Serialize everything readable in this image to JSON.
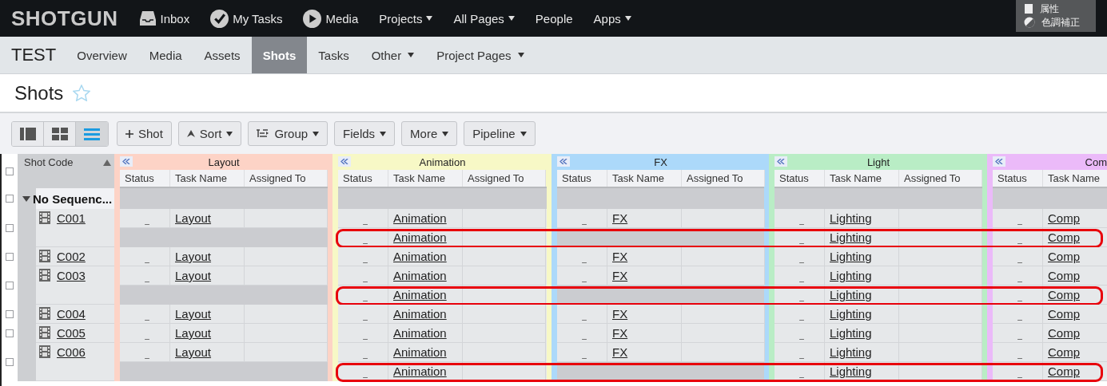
{
  "top_nav": {
    "logo": "SHOTGUN",
    "items": [
      {
        "label": "Inbox",
        "kind": "inbox",
        "menu": false
      },
      {
        "label": "My Tasks",
        "kind": "tasks",
        "menu": false
      },
      {
        "label": "Media",
        "kind": "media",
        "menu": false
      },
      {
        "label": "Projects",
        "kind": "link",
        "menu": true
      },
      {
        "label": "All Pages",
        "kind": "link",
        "menu": true
      },
      {
        "label": "People",
        "kind": "link",
        "menu": false
      },
      {
        "label": "Apps",
        "kind": "link",
        "menu": true
      }
    ]
  },
  "popup_menu": {
    "items": [
      {
        "label": "属性",
        "kind": "properties"
      },
      {
        "label": "色調補正",
        "kind": "adjustment"
      }
    ]
  },
  "project_nav": {
    "project": "TEST",
    "tabs": [
      {
        "label": "Overview",
        "selected": false,
        "menu": false
      },
      {
        "label": "Media",
        "selected": false,
        "menu": false
      },
      {
        "label": "Assets",
        "selected": false,
        "menu": false
      },
      {
        "label": "Shots",
        "selected": true,
        "menu": false
      },
      {
        "label": "Tasks",
        "selected": false,
        "menu": false
      },
      {
        "label": "Other",
        "selected": false,
        "menu": true
      },
      {
        "label": "Project Pages",
        "selected": false,
        "menu": true
      }
    ]
  },
  "page_title": "Shots",
  "favorite": false,
  "toolbar": {
    "view_modes": [
      {
        "kind": "detail",
        "selected": false
      },
      {
        "kind": "grid",
        "selected": false
      },
      {
        "kind": "list",
        "selected": true
      }
    ],
    "buttons": [
      {
        "label": "Shot",
        "kind": "add",
        "menu": false
      },
      {
        "label": "Sort",
        "kind": "sort",
        "menu": true
      },
      {
        "label": "Group",
        "kind": "group",
        "menu": true
      },
      {
        "label": "Fields",
        "kind": "plain",
        "menu": true
      },
      {
        "label": "More",
        "kind": "plain",
        "menu": true
      },
      {
        "label": "Pipeline",
        "kind": "plain",
        "menu": true
      }
    ]
  },
  "table": {
    "code_column": "Shot Code",
    "all_checked": false,
    "groups": [
      {
        "title": "Layout",
        "color": "#fdd3c6",
        "columns": [
          "Status",
          "Task Name",
          "Assigned To"
        ]
      },
      {
        "title": "Animation",
        "color": "#f7f8c6",
        "columns": [
          "Status",
          "Task Name",
          "Assigned To"
        ]
      },
      {
        "title": "FX",
        "color": "#acd9fa",
        "columns": [
          "Status",
          "Task Name",
          "Assigned To"
        ]
      },
      {
        "title": "Light",
        "color": "#b9edc5",
        "columns": [
          "Status",
          "Task Name",
          "Assigned To"
        ]
      },
      {
        "title": "Com",
        "color": "#ebbaf9",
        "columns": [
          "Status",
          "Task Name"
        ]
      }
    ],
    "sequence": {
      "label": "No Sequenc...",
      "expanded": true,
      "checked": false
    },
    "shots": [
      {
        "code": "C001",
        "checked": false,
        "rows": [
          {
            "highlighted": false,
            "tasks": [
              {
                "filled": true,
                "status": "_",
                "name": "Layout"
              },
              {
                "filled": true,
                "status": "_",
                "name": "Animation"
              },
              {
                "filled": true,
                "status": "_",
                "name": "FX"
              },
              {
                "filled": true,
                "status": "_",
                "name": "Lighting"
              },
              {
                "filled": true,
                "status": "_",
                "name": "Comp"
              }
            ]
          },
          {
            "highlighted": true,
            "tasks": [
              {
                "filled": false
              },
              {
                "filled": true,
                "status": "_",
                "name": "Animation"
              },
              {
                "filled": false
              },
              {
                "filled": true,
                "status": "_",
                "name": "Lighting"
              },
              {
                "filled": true,
                "status": "_",
                "name": "Comp"
              }
            ]
          }
        ]
      },
      {
        "code": "C002",
        "checked": false,
        "rows": [
          {
            "highlighted": false,
            "tasks": [
              {
                "filled": true,
                "status": "_",
                "name": "Layout"
              },
              {
                "filled": true,
                "status": "_",
                "name": "Animation"
              },
              {
                "filled": true,
                "status": "_",
                "name": "FX"
              },
              {
                "filled": true,
                "status": "_",
                "name": "Lighting"
              },
              {
                "filled": true,
                "status": "_",
                "name": "Comp"
              }
            ]
          }
        ]
      },
      {
        "code": "C003",
        "checked": false,
        "rows": [
          {
            "highlighted": false,
            "tasks": [
              {
                "filled": true,
                "status": "_",
                "name": "Layout"
              },
              {
                "filled": true,
                "status": "_",
                "name": "Animation"
              },
              {
                "filled": true,
                "status": "_",
                "name": "FX"
              },
              {
                "filled": true,
                "status": "_",
                "name": "Lighting"
              },
              {
                "filled": true,
                "status": "_",
                "name": "Comp"
              }
            ]
          },
          {
            "highlighted": true,
            "tasks": [
              {
                "filled": false
              },
              {
                "filled": true,
                "status": "_",
                "name": "Animation"
              },
              {
                "filled": false
              },
              {
                "filled": true,
                "status": "_",
                "name": "Lighting"
              },
              {
                "filled": true,
                "status": "_",
                "name": "Comp"
              }
            ]
          }
        ]
      },
      {
        "code": "C004",
        "checked": false,
        "rows": [
          {
            "highlighted": false,
            "tasks": [
              {
                "filled": true,
                "status": "_",
                "name": "Layout"
              },
              {
                "filled": true,
                "status": "_",
                "name": "Animation"
              },
              {
                "filled": true,
                "status": "_",
                "name": "FX"
              },
              {
                "filled": true,
                "status": "_",
                "name": "Lighting"
              },
              {
                "filled": true,
                "status": "_",
                "name": "Comp"
              }
            ]
          }
        ]
      },
      {
        "code": "C005",
        "checked": false,
        "rows": [
          {
            "highlighted": false,
            "tasks": [
              {
                "filled": true,
                "status": "_",
                "name": "Layout"
              },
              {
                "filled": true,
                "status": "_",
                "name": "Animation"
              },
              {
                "filled": true,
                "status": "_",
                "name": "FX"
              },
              {
                "filled": true,
                "status": "_",
                "name": "Lighting"
              },
              {
                "filled": true,
                "status": "_",
                "name": "Comp"
              }
            ]
          }
        ]
      },
      {
        "code": "C006",
        "checked": false,
        "rows": [
          {
            "highlighted": false,
            "tasks": [
              {
                "filled": true,
                "status": "_",
                "name": "Layout"
              },
              {
                "filled": true,
                "status": "_",
                "name": "Animation"
              },
              {
                "filled": true,
                "status": "_",
                "name": "FX"
              },
              {
                "filled": true,
                "status": "_",
                "name": "Lighting"
              },
              {
                "filled": true,
                "status": "_",
                "name": "Comp"
              }
            ]
          },
          {
            "highlighted": true,
            "tasks": [
              {
                "filled": false
              },
              {
                "filled": true,
                "status": "_",
                "name": "Animation"
              },
              {
                "filled": false
              },
              {
                "filled": true,
                "status": "_",
                "name": "Lighting"
              },
              {
                "filled": true,
                "status": "_",
                "name": "Comp"
              }
            ]
          }
        ]
      }
    ]
  }
}
